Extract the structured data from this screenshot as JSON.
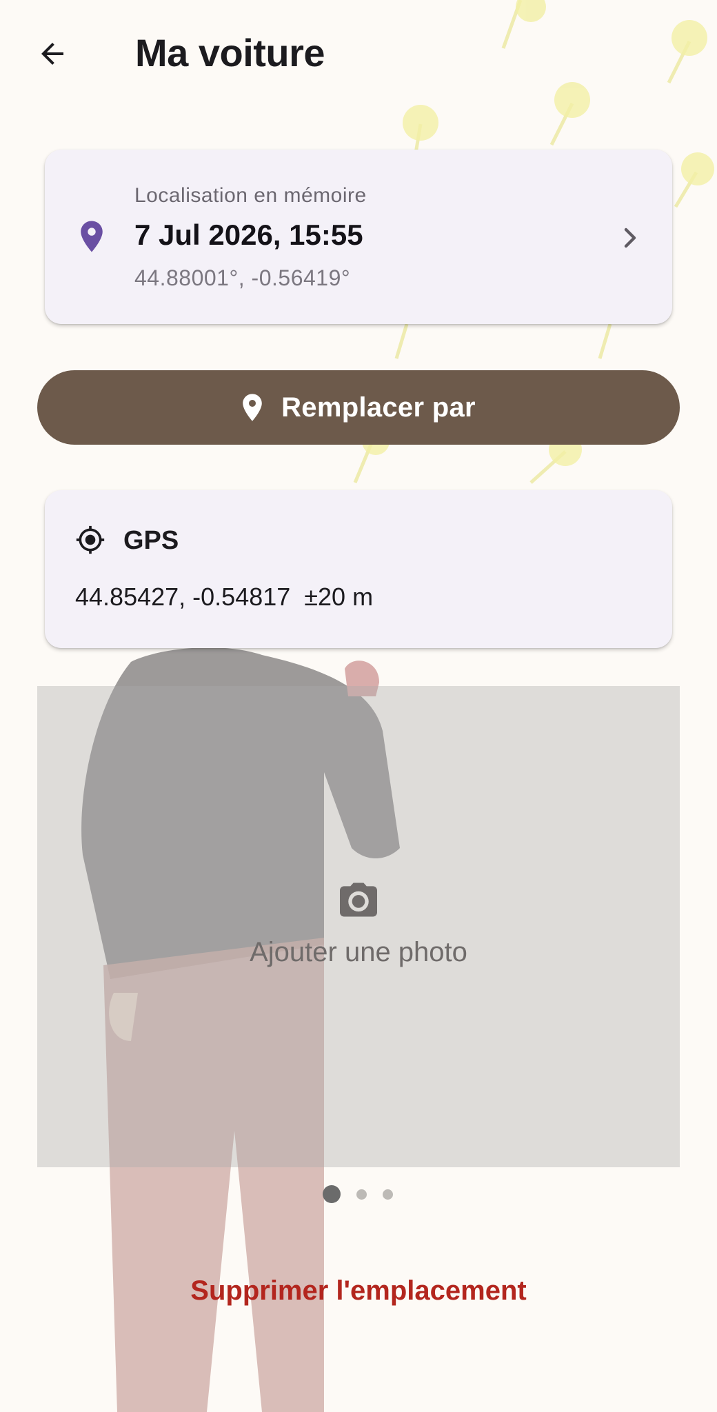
{
  "header": {
    "title": "Ma voiture"
  },
  "saved_location": {
    "label": "Localisation en mémoire",
    "datetime": "7 Jul 2026, 15:55",
    "coords": "44.88001°, -0.56419°"
  },
  "replace_button": {
    "label": "Remplacer par"
  },
  "gps": {
    "title": "GPS",
    "value": "44.85427, -0.54817  ±20 m"
  },
  "photo": {
    "add_label": "Ajouter une photo",
    "pages": 3,
    "current_page": 1
  },
  "delete_button": {
    "label": "Supprimer l'emplacement"
  },
  "colors": {
    "background": "#fdfaf6",
    "card": "#f4f1f8",
    "pin": "#6a4fa3",
    "button": "#6d5a4b",
    "danger": "#b3261e"
  },
  "icons": [
    "arrow-back-icon",
    "location-pin-icon",
    "chevron-right-icon",
    "gps-fixed-icon",
    "camera-icon"
  ]
}
